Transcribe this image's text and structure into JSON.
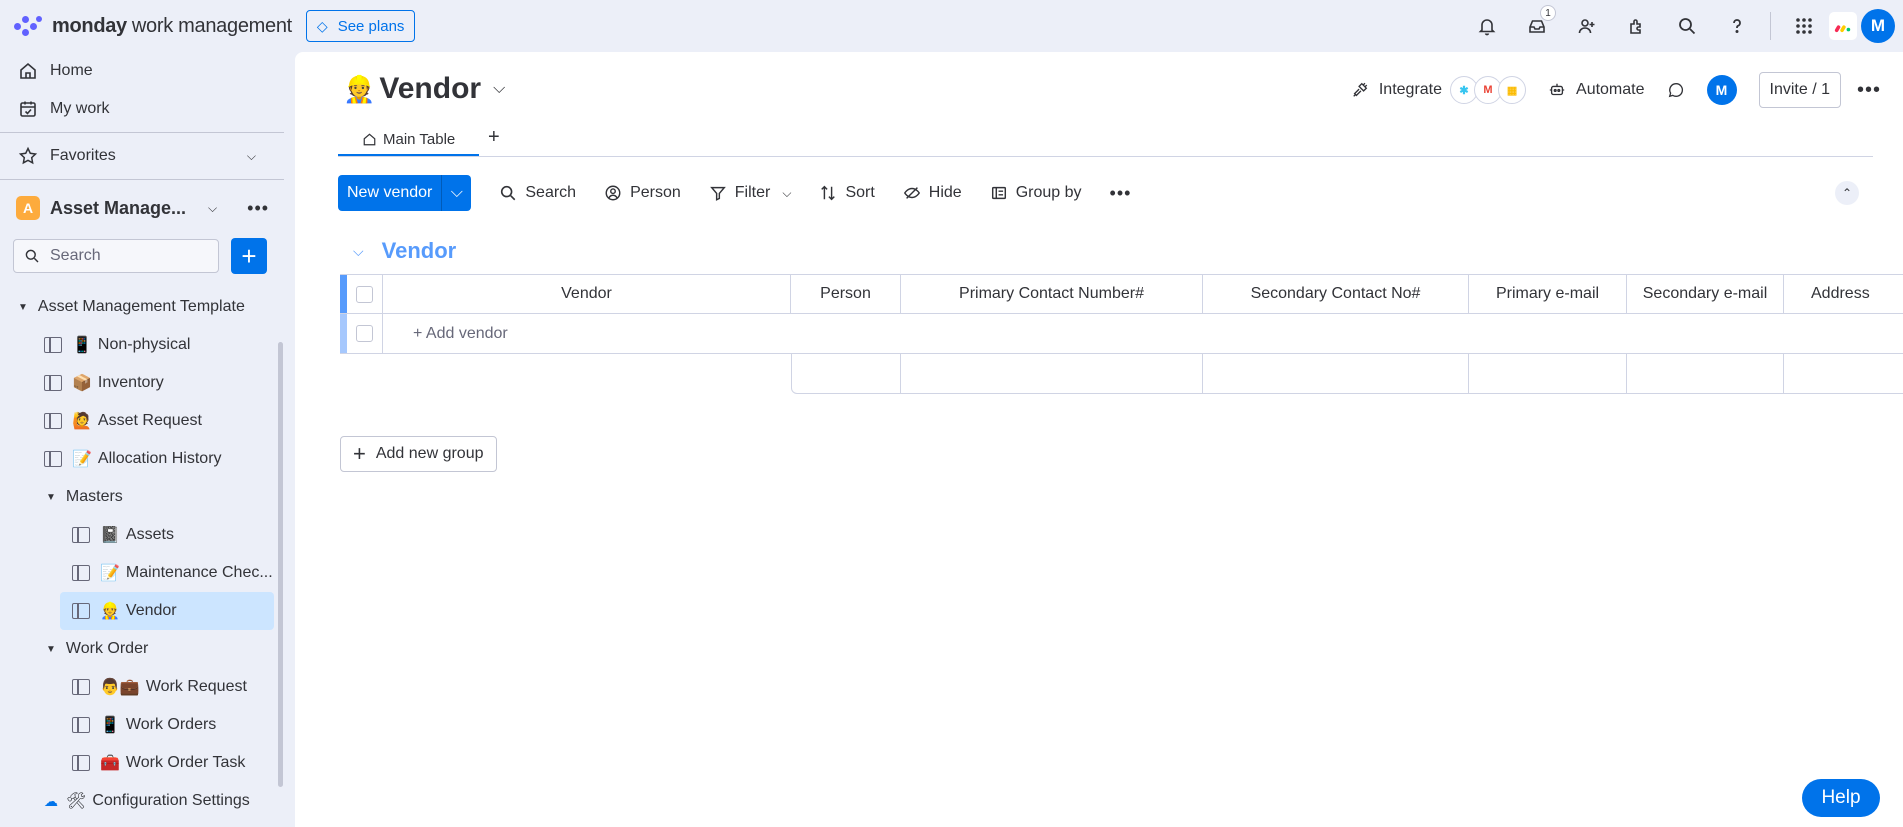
{
  "topbar": {
    "brand": "monday",
    "brand_sub": "work management",
    "see_plans": "See plans",
    "inbox_badge": "1",
    "avatar_initial": "M"
  },
  "sidebar": {
    "home": "Home",
    "my_work": "My work",
    "favorites": "Favorites",
    "workspace_initial": "A",
    "workspace_name": "Asset Manage...",
    "search_placeholder": "Search",
    "tree": [
      {
        "label": "Asset Management Template"
      },
      {
        "label": "Non-physical",
        "emoji": "📱"
      },
      {
        "label": "Inventory",
        "emoji": "📦"
      },
      {
        "label": "Asset Request",
        "emoji": "🙋"
      },
      {
        "label": "Allocation History",
        "emoji": "📝"
      },
      {
        "label": "Masters"
      },
      {
        "label": "Assets",
        "emoji": "📓"
      },
      {
        "label": "Maintenance Chec...",
        "emoji": "📝"
      },
      {
        "label": "Vendor",
        "emoji": "👷"
      },
      {
        "label": "Work Order"
      },
      {
        "label": "Work Request",
        "emoji": "👨💼"
      },
      {
        "label": "Work Orders",
        "emoji": "📱"
      },
      {
        "label": "Work Order Task",
        "emoji": "🧰"
      },
      {
        "label": "Configuration Settings",
        "emoji": "🛠"
      }
    ]
  },
  "board": {
    "emoji": "👷",
    "title": "Vendor",
    "integrate": "Integrate",
    "automate": "Automate",
    "avatar_initial": "M",
    "invite": "Invite / 1",
    "tab_main": "Main Table",
    "new_item": "New vendor",
    "toolbar": {
      "search": "Search",
      "person": "Person",
      "filter": "Filter",
      "sort": "Sort",
      "hide": "Hide",
      "group_by": "Group by"
    },
    "group_title": "Vendor",
    "columns": [
      "Vendor",
      "Person",
      "Primary Contact Number#",
      "Secondary Contact No#",
      "Primary e-mail",
      "Secondary e-mail",
      "Address"
    ],
    "add_item": "+ Add vendor",
    "add_group": "Add new group",
    "help": "Help"
  },
  "colors": {
    "accent": "#0073ea",
    "group": "#579bfc",
    "background": "#eceff8",
    "active_item": "#cce5ff"
  }
}
